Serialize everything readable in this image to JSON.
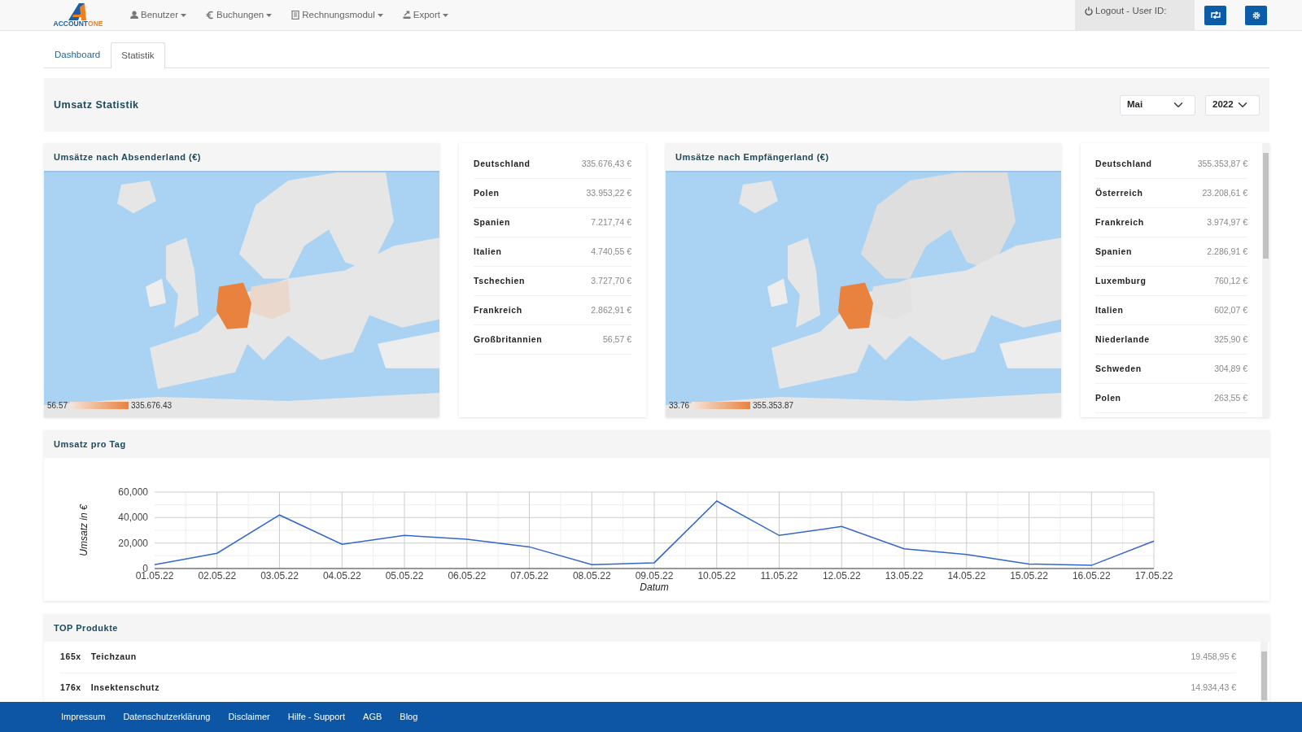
{
  "logo": {
    "text_1": "ACCOUNT",
    "text_2": "ONE"
  },
  "menu": [
    {
      "label": "Benutzer"
    },
    {
      "label": "Buchungen"
    },
    {
      "label": "Rechnungsmodul"
    },
    {
      "label": "Export"
    }
  ],
  "logout": "Logout - User ID:",
  "tabs": [
    {
      "label": "Dashboard",
      "selected": false
    },
    {
      "label": "Statistik",
      "selected": true
    }
  ],
  "header": {
    "title": "Umsatz Statistik",
    "month": "Mai",
    "year": "2022"
  },
  "maps": [
    {
      "title": "Umsätze nach Absenderland (€)",
      "legend_min": "56.57",
      "legend_max": "335.676.43",
      "rows": [
        {
          "country": "Deutschland",
          "amount": "335.676,43 €"
        },
        {
          "country": "Polen",
          "amount": "33.953,22 €"
        },
        {
          "country": "Spanien",
          "amount": "7.217,74 €"
        },
        {
          "country": "Italien",
          "amount": "4.740,55 €"
        },
        {
          "country": "Tschechien",
          "amount": "3.727,70 €"
        },
        {
          "country": "Frankreich",
          "amount": "2.862,91 €"
        },
        {
          "country": "Großbritannien",
          "amount": "56,57 €"
        }
      ]
    },
    {
      "title": "Umsätze nach Empfängerland (€)",
      "legend_min": "33.76",
      "legend_max": "355.353.87",
      "rows": [
        {
          "country": "Deutschland",
          "amount": "355.353,87 €"
        },
        {
          "country": "Österreich",
          "amount": "23.208,61 €"
        },
        {
          "country": "Frankreich",
          "amount": "3.974,97 €"
        },
        {
          "country": "Spanien",
          "amount": "2.286,91 €"
        },
        {
          "country": "Luxemburg",
          "amount": "760,12 €"
        },
        {
          "country": "Italien",
          "amount": "602,07 €"
        },
        {
          "country": "Niederlande",
          "amount": "325,90 €"
        },
        {
          "country": "Schweden",
          "amount": "304,89 €"
        },
        {
          "country": "Polen",
          "amount": "263,55 €"
        }
      ]
    }
  ],
  "daily": {
    "title": "Umsatz pro Tag",
    "chart_data": {
      "type": "line",
      "xlabel": "Datum",
      "ylabel": "Umsatz in €",
      "categories": [
        "01.05.22",
        "02.05.22",
        "03.05.22",
        "04.05.22",
        "05.05.22",
        "06.05.22",
        "07.05.22",
        "08.05.22",
        "09.05.22",
        "10.05.22",
        "11.05.22",
        "12.05.22",
        "13.05.22",
        "14.05.22",
        "15.05.22",
        "16.05.22",
        "17.05.22"
      ],
      "series": [
        {
          "color": "#3366cc",
          "values": [
            3000,
            12000,
            42000,
            19000,
            26000,
            23000,
            17000,
            3000,
            4500,
            53000,
            26000,
            33000,
            15500,
            11000,
            3500,
            2500,
            21500
          ]
        }
      ],
      "ylim": [
        0,
        60000
      ],
      "grid": true,
      "yticks": [
        {
          "value": 0,
          "label": "0"
        },
        {
          "value": 20000,
          "label": "20,000"
        },
        {
          "value": 40000,
          "label": "40,000"
        },
        {
          "value": 60000,
          "label": "60,000"
        }
      ]
    }
  },
  "products": {
    "title": "TOP Produkte",
    "rows": [
      {
        "qty": "165x",
        "name": "Teichzaun",
        "amount": "19.458,95 €"
      },
      {
        "qty": "176x",
        "name": "Insektenschutz",
        "amount": "14.934,43 €"
      }
    ]
  },
  "footer": [
    {
      "label": "Impressum"
    },
    {
      "label": "Datenschutzerklärung"
    },
    {
      "label": "Disclaimer"
    },
    {
      "label": "Hilfe - Support"
    },
    {
      "label": "AGB"
    },
    {
      "label": "Blog"
    }
  ]
}
